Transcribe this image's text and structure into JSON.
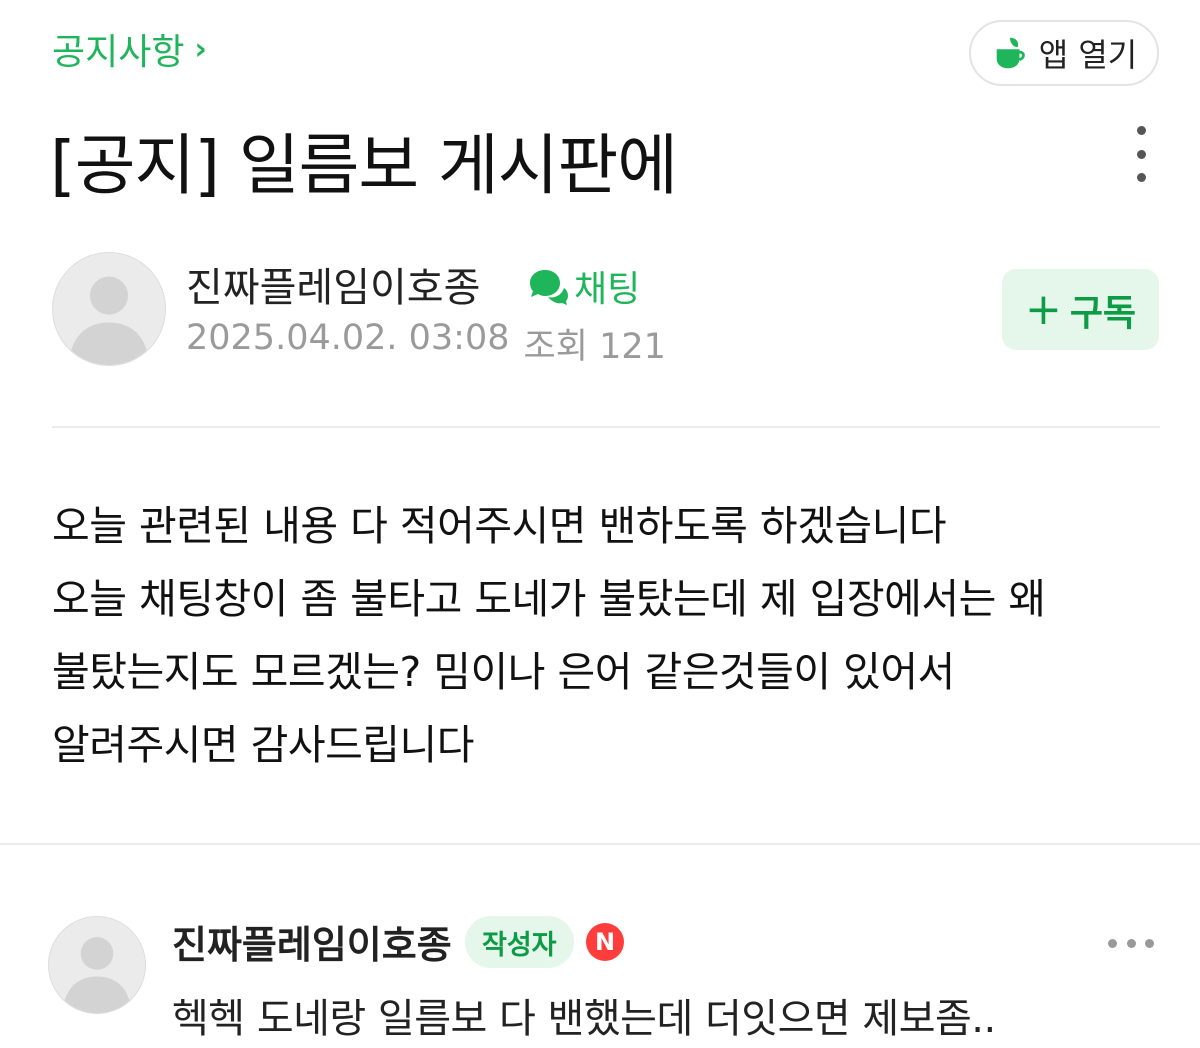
{
  "header": {
    "board_label": "공지사항",
    "board_chevron": "›",
    "app_open_label": "앱 열기"
  },
  "post": {
    "title": "[공지] 일름보 게시판에",
    "author": "진짜플레임이호종",
    "chat_label": "채팅",
    "date": "2025.04.02. 03:08",
    "views_label": "조회",
    "views": "121",
    "subscribe_label": "구독",
    "subscribe_plus": "+",
    "body_lines": [
      "오늘 관련된 내용 다 적어주시면 밴하도록 하겠습니다",
      "오늘 채팅창이 좀 불타고 도네가 불탔는데 제 입장에서는 왜",
      "불탔는지도 모르겠는? 밈이나 은어 같은것들이 있어서",
      "알려주시면 감사드립니다"
    ]
  },
  "comment": {
    "author": "진짜플레임이호종",
    "badge": "작성자",
    "new_badge": "N",
    "text": "헥헥 도네랑 일름보 다 밴했는데 더잇으면 제보좀.."
  },
  "colors": {
    "accent_green": "#1fb55a",
    "subscribe_bg": "#e4f7ea",
    "new_badge_red": "#ff3d3d",
    "meta_gray": "#9a9a9a"
  },
  "icons": {
    "app_open": "cup-leaf-icon",
    "menu": "more-vertical-icon",
    "chat": "chat-bubbles-icon",
    "avatar": "default-user-icon",
    "comment_menu": "more-horizontal-icon"
  }
}
